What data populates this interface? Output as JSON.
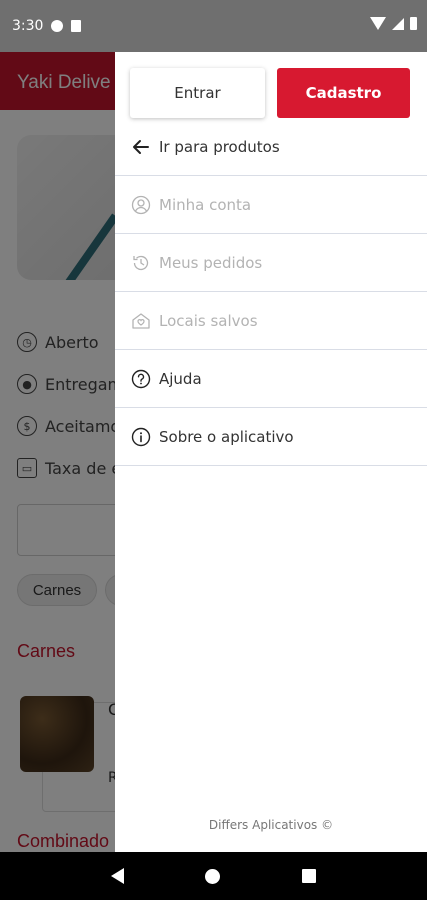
{
  "status_bar": {
    "time": "3:30"
  },
  "background_app": {
    "title": "Yaki Delive",
    "info_rows": [
      "Aberto",
      "Entregam",
      "Aceitamo",
      "Taxa de e"
    ],
    "chip": "Carnes",
    "section1": "Carnes",
    "section2": "Combinado",
    "product_letter": "C",
    "product_letter2": "R"
  },
  "drawer": {
    "login_label": "Entrar",
    "signup_label": "Cadastro",
    "back_label": "Ir para produtos",
    "items": [
      {
        "label": "Minha conta",
        "icon": "user-icon",
        "enabled": false
      },
      {
        "label": "Meus pedidos",
        "icon": "history-icon",
        "enabled": false
      },
      {
        "label": "Locais salvos",
        "icon": "saved-places-icon",
        "enabled": false
      },
      {
        "label": "Ajuda",
        "icon": "help-icon",
        "enabled": true
      },
      {
        "label": "Sobre o aplicativo",
        "icon": "info-icon",
        "enabled": true
      }
    ],
    "footer": "Differs Aplicativos ©"
  },
  "colors": {
    "accent": "#d71930",
    "header": "#c4142c",
    "disabled": "#b3b3b3"
  }
}
